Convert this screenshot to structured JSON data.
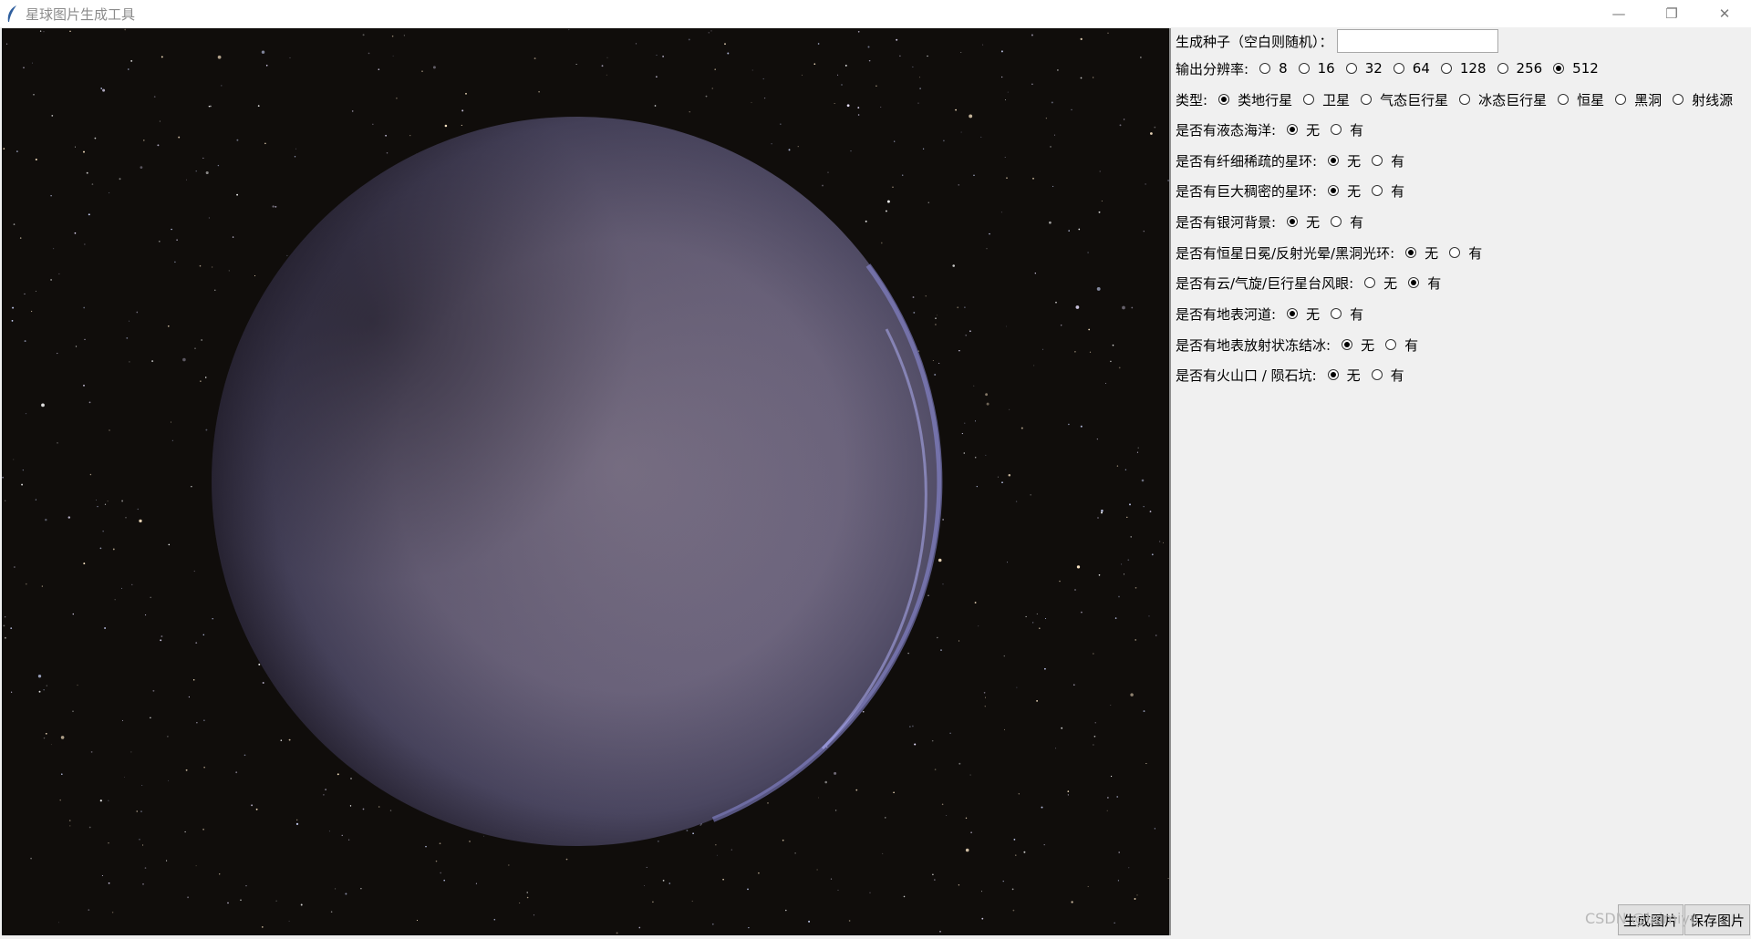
{
  "window": {
    "title": "星球图片生成工具",
    "controls": {
      "minimize": "—",
      "restore": "❐",
      "close": "✕"
    }
  },
  "colors": {
    "background": "#f0f0f0",
    "canvas_bg": "#100d0b",
    "planet": "#7a7088"
  },
  "form": {
    "seed": {
      "label": "生成种子（空白则随机）：",
      "value": ""
    },
    "resolution": {
      "label": "输出分辨率:",
      "options": [
        "8",
        "16",
        "32",
        "64",
        "128",
        "256",
        "512"
      ],
      "selected": "512"
    },
    "type": {
      "label": "类型:",
      "options": [
        "类地行星",
        "卫星",
        "气态巨行星",
        "冰态巨行星",
        "恒星",
        "黑洞",
        "射线源"
      ],
      "selected": "类地行星"
    },
    "ocean": {
      "label": "是否有液态海洋:",
      "options": [
        "无",
        "有"
      ],
      "selected": "无"
    },
    "thin_ring": {
      "label": "是否有纤细稀疏的星环:",
      "options": [
        "无",
        "有"
      ],
      "selected": "无"
    },
    "big_ring": {
      "label": "是否有巨大稠密的星环:",
      "options": [
        "无",
        "有"
      ],
      "selected": "无"
    },
    "galaxy_bg": {
      "label": "是否有银河背景:",
      "options": [
        "无",
        "有"
      ],
      "selected": "无"
    },
    "star_halo": {
      "label": "是否有恒星日冕/反射光晕/黑洞光环:",
      "options": [
        "无",
        "有"
      ],
      "selected": "无"
    },
    "clouds": {
      "label": "是否有云/气旋/巨行星台风眼:",
      "options": [
        "无",
        "有"
      ],
      "selected": "有"
    },
    "rivers": {
      "label": "是否有地表河道:",
      "options": [
        "无",
        "有"
      ],
      "selected": "无"
    },
    "ice": {
      "label": "是否有地表放射状冻结冰:",
      "options": [
        "无",
        "有"
      ],
      "selected": "无"
    },
    "craters": {
      "label": "是否有火山口 / 陨石坑:",
      "options": [
        "无",
        "有"
      ],
      "selected": "无"
    }
  },
  "buttons": {
    "generate": "生成图片",
    "save": "保存图片"
  },
  "watermark": "CSDN @laimiyu"
}
